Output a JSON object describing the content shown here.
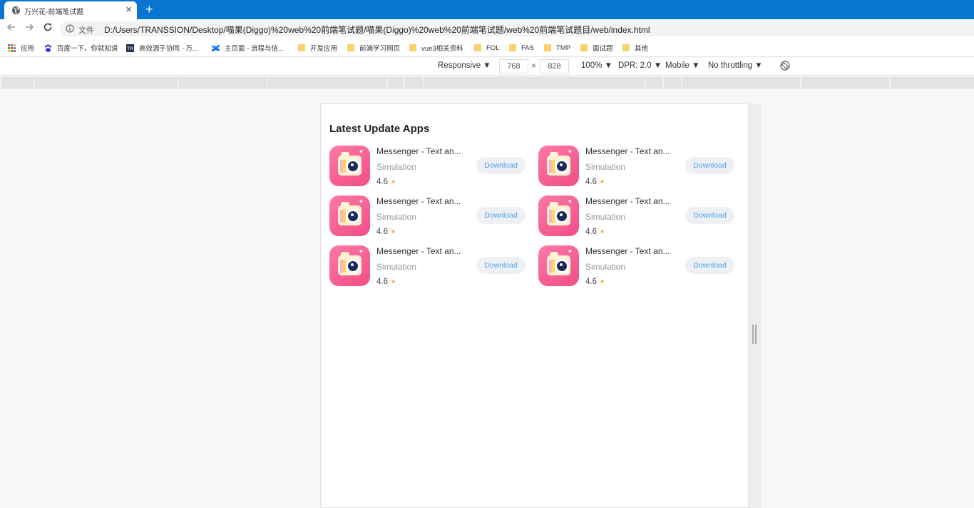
{
  "browser": {
    "tab_title": "万兴花-前端笔试题",
    "tab_close": "×",
    "new_tab": "+",
    "address_label": "文件",
    "url": "D:/Users/TRANSSION/Desktop/喵果(Diggo)%20web%20前端笔试题/喵果(Diggo)%20web%20前端笔试题/web%20前端笔试题目/web/index.html",
    "bookmarks": [
      {
        "label": "应用",
        "icon": "apps-grid-icon"
      },
      {
        "label": "百度一下，你就知道",
        "icon": "baidu-icon"
      },
      {
        "label": "高效源于协同 - 万...",
        "icon": "tr-icon"
      },
      {
        "label": "主页面 - 流程与信...",
        "icon": "confluence-icon"
      },
      {
        "label": "开发应用",
        "icon": "folder-icon"
      },
      {
        "label": "前端学习网页",
        "icon": "folder-icon"
      },
      {
        "label": "vue3相关资料",
        "icon": "folder-icon"
      },
      {
        "label": "FOL",
        "icon": "folder-icon"
      },
      {
        "label": "FAS",
        "icon": "folder-icon"
      },
      {
        "label": "TMP",
        "icon": "folder-icon"
      },
      {
        "label": "面试题",
        "icon": "folder-icon"
      },
      {
        "label": "其他",
        "icon": "folder-icon"
      }
    ]
  },
  "devtools": {
    "device": "Responsive ▼",
    "width": "768",
    "times": "×",
    "height": "828",
    "zoom": "100% ▼",
    "dpr": "DPR: 2.0 ▼",
    "mode": "Mobile ▼",
    "throttling": "No throttling ▼"
  },
  "page": {
    "section_title": "Latest Update Apps",
    "apps": [
      {
        "name": "Messenger - Text an...",
        "category": "Simulation",
        "rating": "4.6",
        "star": "★",
        "button": "Download"
      },
      {
        "name": "Messenger - Text an...",
        "category": "Simulation",
        "rating": "4.6",
        "star": "★",
        "button": "Download"
      },
      {
        "name": "Messenger - Text an...",
        "category": "Simulation",
        "rating": "4.6",
        "star": "★",
        "button": "Download"
      },
      {
        "name": "Messenger - Text an...",
        "category": "Simulation",
        "rating": "4.6",
        "star": "★",
        "button": "Download"
      },
      {
        "name": "Messenger - Text an...",
        "category": "Simulation",
        "rating": "4.6",
        "star": "★",
        "button": "Download"
      },
      {
        "name": "Messenger - Text an...",
        "category": "Simulation",
        "rating": "4.6",
        "star": "★",
        "button": "Download"
      }
    ]
  },
  "colors": {
    "tab_strip": "#0875d1",
    "download_text": "#4aa3f0",
    "star": "#f5a623",
    "icon_pink": "#f24d86"
  }
}
